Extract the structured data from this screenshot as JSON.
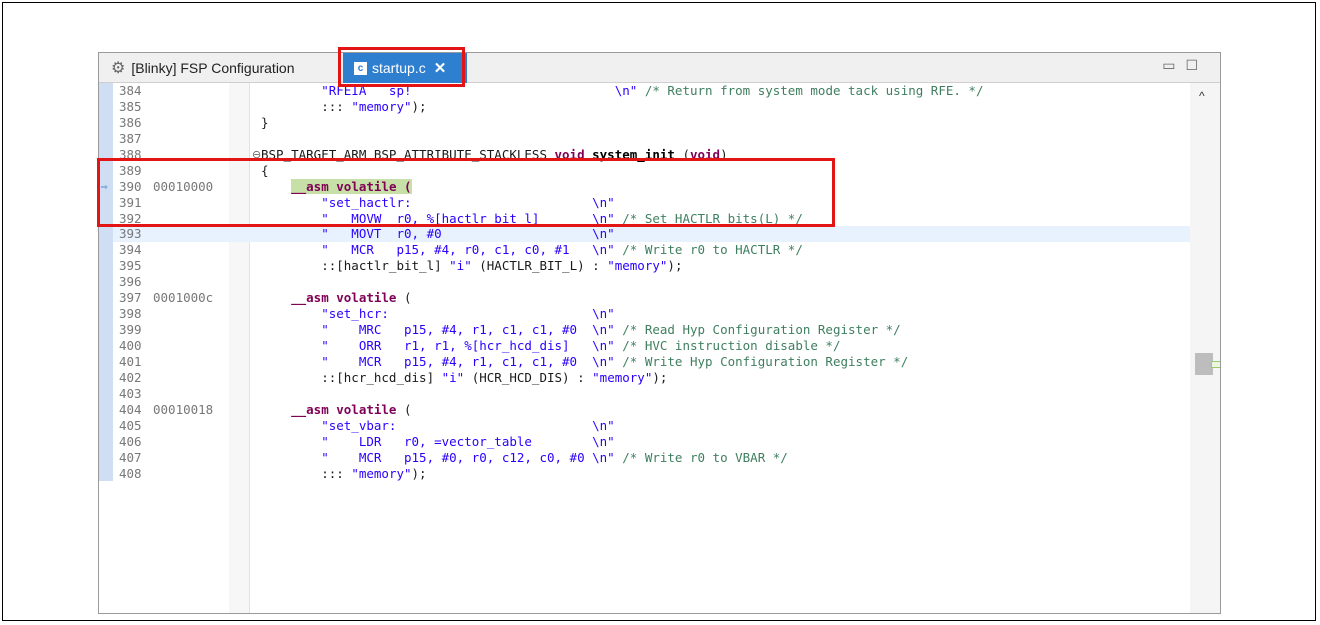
{
  "tabs": [
    {
      "label": "[Blinky] FSP Configuration",
      "icon": "gear-icon",
      "active": false
    },
    {
      "label": "startup.c",
      "icon": "c-file-icon",
      "active": true
    }
  ],
  "lines": [
    {
      "num": "384",
      "addr": "",
      "segments": [
        [
          "str",
          "        \"RFEIA   sp!                           \\n\""
        ],
        [
          "cmt",
          " /* Return from system mode tack using RFE. */"
        ]
      ]
    },
    {
      "num": "385",
      "addr": "",
      "segments": [
        [
          "",
          "        ::: "
        ],
        [
          "str",
          "\"memory\""
        ],
        [
          "",
          ");"
        ]
      ]
    },
    {
      "num": "386",
      "addr": "",
      "segments": [
        [
          "",
          "}"
        ]
      ]
    },
    {
      "num": "387",
      "addr": "",
      "segments": []
    },
    {
      "num": "388",
      "addr": "",
      "fold": "⊖",
      "segments": [
        [
          "",
          "BSP_TARGET_ARM BSP_ATTRIBUTE_STACKLESS "
        ],
        [
          "kw",
          "void"
        ],
        [
          "fn",
          " system_init "
        ],
        [
          "",
          "("
        ],
        [
          "kw",
          "void"
        ],
        [
          "",
          ")"
        ]
      ]
    },
    {
      "num": "389",
      "addr": "",
      "segments": [
        [
          "",
          "{"
        ]
      ]
    },
    {
      "num": "390",
      "addr": "00010000",
      "arrow": true,
      "segments": [
        [
          "hlkw",
          "    __asm volatile ("
        ]
      ]
    },
    {
      "num": "391",
      "addr": "",
      "segments": [
        [
          "str",
          "        \"set_hactlr:                        \\n\""
        ]
      ]
    },
    {
      "num": "392",
      "addr": "",
      "segments": [
        [
          "str",
          "        \"   MOVW  r0, %[hactlr_bit_l]       \\n\""
        ],
        [
          "cmt",
          " /* Set HACTLR bits(L) */"
        ]
      ]
    },
    {
      "num": "393",
      "addr": "",
      "cur": true,
      "segments": [
        [
          "str",
          "        \"   MOVT  r0, #0                    \\n\""
        ]
      ]
    },
    {
      "num": "394",
      "addr": "",
      "segments": [
        [
          "str",
          "        \"   MCR   p15, #4, r0, c1, c0, #1   \\n\""
        ],
        [
          "cmt",
          " /* Write r0 to HACTLR */"
        ]
      ]
    },
    {
      "num": "395",
      "addr": "",
      "segments": [
        [
          "",
          "        ::[hactlr_bit_l] "
        ],
        [
          "str",
          "\"i\""
        ],
        [
          "",
          " (HACTLR_BIT_L) : "
        ],
        [
          "str",
          "\"memory\""
        ],
        [
          "",
          ");"
        ]
      ]
    },
    {
      "num": "396",
      "addr": "",
      "segments": []
    },
    {
      "num": "397",
      "addr": "0001000c",
      "segments": [
        [
          "kw",
          "    __asm volatile "
        ],
        [
          "",
          "("
        ]
      ]
    },
    {
      "num": "398",
      "addr": "",
      "segments": [
        [
          "str",
          "        \"set_hcr:                           \\n\""
        ]
      ]
    },
    {
      "num": "399",
      "addr": "",
      "segments": [
        [
          "str",
          "        \"    MRC   p15, #4, r1, c1, c1, #0  \\n\""
        ],
        [
          "cmt",
          " /* Read Hyp Configuration Register */"
        ]
      ]
    },
    {
      "num": "400",
      "addr": "",
      "segments": [
        [
          "str",
          "        \"    ORR   r1, r1, %[hcr_hcd_dis]   \\n\""
        ],
        [
          "cmt",
          " /* HVC instruction disable */"
        ]
      ]
    },
    {
      "num": "401",
      "addr": "",
      "segments": [
        [
          "str",
          "        \"    MCR   p15, #4, r1, c1, c1, #0  \\n\""
        ],
        [
          "cmt",
          " /* Write Hyp Configuration Register */"
        ]
      ]
    },
    {
      "num": "402",
      "addr": "",
      "segments": [
        [
          "",
          "        ::[hcr_hcd_dis] "
        ],
        [
          "str",
          "\"i\""
        ],
        [
          "",
          " (HCR_HCD_DIS) : "
        ],
        [
          "str",
          "\"memory\""
        ],
        [
          "",
          ");"
        ]
      ]
    },
    {
      "num": "403",
      "addr": "",
      "segments": []
    },
    {
      "num": "404",
      "addr": "00010018",
      "segments": [
        [
          "kw",
          "    __asm volatile "
        ],
        [
          "",
          "("
        ]
      ]
    },
    {
      "num": "405",
      "addr": "",
      "segments": [
        [
          "str",
          "        \"set_vbar:                          \\n\""
        ]
      ]
    },
    {
      "num": "406",
      "addr": "",
      "segments": [
        [
          "str",
          "        \"    LDR   r0, =vector_table        \\n\""
        ]
      ]
    },
    {
      "num": "407",
      "addr": "",
      "segments": [
        [
          "str",
          "        \"    MCR   p15, #0, r0, c12, c0, #0 \\n\""
        ],
        [
          "cmt",
          " /* Write r0 to VBAR */"
        ]
      ]
    },
    {
      "num": "408",
      "addr": "",
      "segments": [
        [
          "",
          "        ::: "
        ],
        [
          "str",
          "\"memory\""
        ],
        [
          "",
          ");"
        ]
      ]
    }
  ],
  "window_buttons": {
    "minimize": "▭",
    "maximize": "☐"
  },
  "scroll": {
    "up_arrow": "^"
  }
}
